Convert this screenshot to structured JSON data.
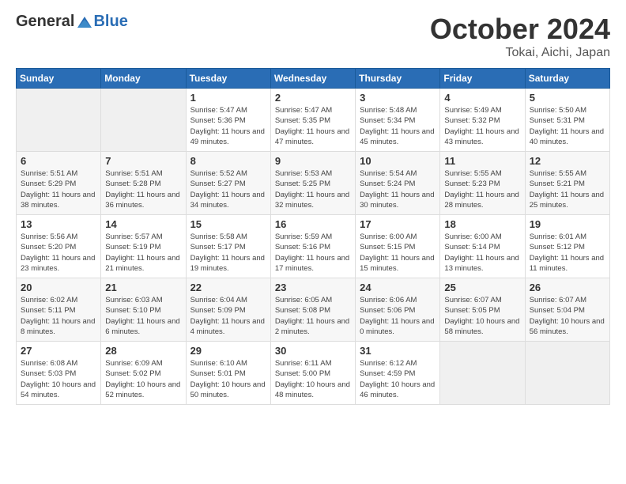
{
  "logo": {
    "general": "General",
    "blue": "Blue"
  },
  "title": "October 2024",
  "location": "Tokai, Aichi, Japan",
  "days_of_week": [
    "Sunday",
    "Monday",
    "Tuesday",
    "Wednesday",
    "Thursday",
    "Friday",
    "Saturday"
  ],
  "weeks": [
    [
      {
        "day": "",
        "info": ""
      },
      {
        "day": "",
        "info": ""
      },
      {
        "day": "1",
        "info": "Sunrise: 5:47 AM\nSunset: 5:36 PM\nDaylight: 11 hours and 49 minutes."
      },
      {
        "day": "2",
        "info": "Sunrise: 5:47 AM\nSunset: 5:35 PM\nDaylight: 11 hours and 47 minutes."
      },
      {
        "day": "3",
        "info": "Sunrise: 5:48 AM\nSunset: 5:34 PM\nDaylight: 11 hours and 45 minutes."
      },
      {
        "day": "4",
        "info": "Sunrise: 5:49 AM\nSunset: 5:32 PM\nDaylight: 11 hours and 43 minutes."
      },
      {
        "day": "5",
        "info": "Sunrise: 5:50 AM\nSunset: 5:31 PM\nDaylight: 11 hours and 40 minutes."
      }
    ],
    [
      {
        "day": "6",
        "info": "Sunrise: 5:51 AM\nSunset: 5:29 PM\nDaylight: 11 hours and 38 minutes."
      },
      {
        "day": "7",
        "info": "Sunrise: 5:51 AM\nSunset: 5:28 PM\nDaylight: 11 hours and 36 minutes."
      },
      {
        "day": "8",
        "info": "Sunrise: 5:52 AM\nSunset: 5:27 PM\nDaylight: 11 hours and 34 minutes."
      },
      {
        "day": "9",
        "info": "Sunrise: 5:53 AM\nSunset: 5:25 PM\nDaylight: 11 hours and 32 minutes."
      },
      {
        "day": "10",
        "info": "Sunrise: 5:54 AM\nSunset: 5:24 PM\nDaylight: 11 hours and 30 minutes."
      },
      {
        "day": "11",
        "info": "Sunrise: 5:55 AM\nSunset: 5:23 PM\nDaylight: 11 hours and 28 minutes."
      },
      {
        "day": "12",
        "info": "Sunrise: 5:55 AM\nSunset: 5:21 PM\nDaylight: 11 hours and 25 minutes."
      }
    ],
    [
      {
        "day": "13",
        "info": "Sunrise: 5:56 AM\nSunset: 5:20 PM\nDaylight: 11 hours and 23 minutes."
      },
      {
        "day": "14",
        "info": "Sunrise: 5:57 AM\nSunset: 5:19 PM\nDaylight: 11 hours and 21 minutes."
      },
      {
        "day": "15",
        "info": "Sunrise: 5:58 AM\nSunset: 5:17 PM\nDaylight: 11 hours and 19 minutes."
      },
      {
        "day": "16",
        "info": "Sunrise: 5:59 AM\nSunset: 5:16 PM\nDaylight: 11 hours and 17 minutes."
      },
      {
        "day": "17",
        "info": "Sunrise: 6:00 AM\nSunset: 5:15 PM\nDaylight: 11 hours and 15 minutes."
      },
      {
        "day": "18",
        "info": "Sunrise: 6:00 AM\nSunset: 5:14 PM\nDaylight: 11 hours and 13 minutes."
      },
      {
        "day": "19",
        "info": "Sunrise: 6:01 AM\nSunset: 5:12 PM\nDaylight: 11 hours and 11 minutes."
      }
    ],
    [
      {
        "day": "20",
        "info": "Sunrise: 6:02 AM\nSunset: 5:11 PM\nDaylight: 11 hours and 8 minutes."
      },
      {
        "day": "21",
        "info": "Sunrise: 6:03 AM\nSunset: 5:10 PM\nDaylight: 11 hours and 6 minutes."
      },
      {
        "day": "22",
        "info": "Sunrise: 6:04 AM\nSunset: 5:09 PM\nDaylight: 11 hours and 4 minutes."
      },
      {
        "day": "23",
        "info": "Sunrise: 6:05 AM\nSunset: 5:08 PM\nDaylight: 11 hours and 2 minutes."
      },
      {
        "day": "24",
        "info": "Sunrise: 6:06 AM\nSunset: 5:06 PM\nDaylight: 11 hours and 0 minutes."
      },
      {
        "day": "25",
        "info": "Sunrise: 6:07 AM\nSunset: 5:05 PM\nDaylight: 10 hours and 58 minutes."
      },
      {
        "day": "26",
        "info": "Sunrise: 6:07 AM\nSunset: 5:04 PM\nDaylight: 10 hours and 56 minutes."
      }
    ],
    [
      {
        "day": "27",
        "info": "Sunrise: 6:08 AM\nSunset: 5:03 PM\nDaylight: 10 hours and 54 minutes."
      },
      {
        "day": "28",
        "info": "Sunrise: 6:09 AM\nSunset: 5:02 PM\nDaylight: 10 hours and 52 minutes."
      },
      {
        "day": "29",
        "info": "Sunrise: 6:10 AM\nSunset: 5:01 PM\nDaylight: 10 hours and 50 minutes."
      },
      {
        "day": "30",
        "info": "Sunrise: 6:11 AM\nSunset: 5:00 PM\nDaylight: 10 hours and 48 minutes."
      },
      {
        "day": "31",
        "info": "Sunrise: 6:12 AM\nSunset: 4:59 PM\nDaylight: 10 hours and 46 minutes."
      },
      {
        "day": "",
        "info": ""
      },
      {
        "day": "",
        "info": ""
      }
    ]
  ]
}
